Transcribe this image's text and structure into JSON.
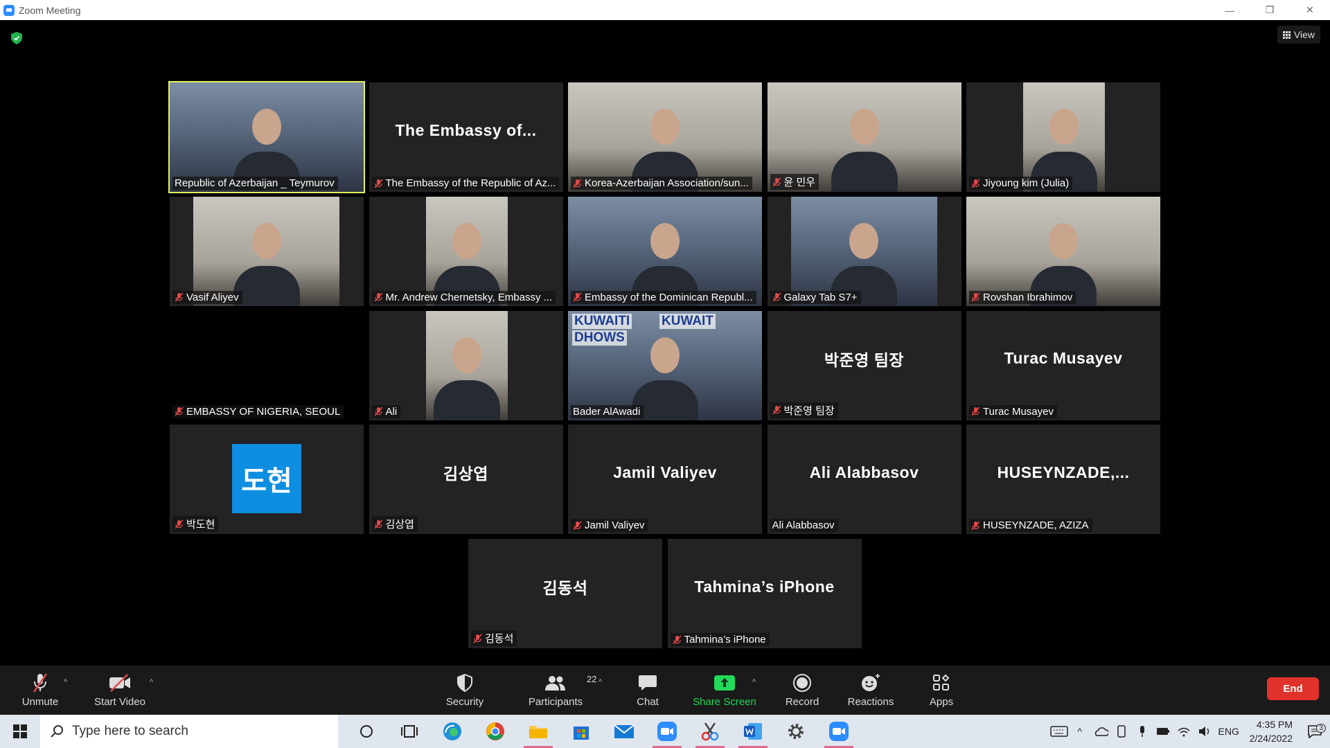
{
  "window": {
    "title": "Zoom Meeting"
  },
  "view_button": {
    "label": "View"
  },
  "participants": [
    {
      "name": "Republic of Azerbaijan _ Teymurov",
      "muted": false,
      "video": "office",
      "active": true
    },
    {
      "name": "The Embassy of the Republic of Az...",
      "muted": true,
      "display": "The  Embassy  of..."
    },
    {
      "name": "Korea-Azerbaijan Association/sun...",
      "muted": true,
      "video": "room"
    },
    {
      "name": "윤 민우",
      "muted": true,
      "video": "room"
    },
    {
      "name": "Jiyoung kim (Julia)",
      "muted": true,
      "video": "room"
    },
    {
      "name": "Vasif Aliyev",
      "muted": true,
      "video": "room"
    },
    {
      "name": "Mr. Andrew Chernetsky, Embassy ...",
      "muted": true,
      "video": "room"
    },
    {
      "name": "Embassy of the Dominican Republ...",
      "muted": true,
      "video": "office"
    },
    {
      "name": "Galaxy Tab S7+",
      "muted": true,
      "video": "office"
    },
    {
      "name": "Rovshan Ibrahimov",
      "muted": true,
      "video": "room"
    },
    {
      "name": "EMBASSY OF NIGERIA, SEOUL",
      "muted": true,
      "video": "dark"
    },
    {
      "name": "Ali",
      "muted": true,
      "video": "room"
    },
    {
      "name": "Bader AlAwadi",
      "muted": false,
      "video": "office",
      "poster_text": [
        "KUWAITI",
        "DHOWS",
        "KUWAIT"
      ]
    },
    {
      "name": "박준영 팀장",
      "muted": true,
      "display": "박준영 팀장"
    },
    {
      "name": "Turac Musayev",
      "muted": true,
      "display": "Turac Musayev"
    },
    {
      "name": "박도현",
      "muted": true,
      "avatar": "도현",
      "avatar_color": "#0e8ee0"
    },
    {
      "name": "김상엽",
      "muted": true,
      "display": "김상엽"
    },
    {
      "name": "Jamil Valiyev",
      "muted": true,
      "display": "Jamil Valiyev"
    },
    {
      "name": "Ali Alabbasov",
      "muted": false,
      "display": "Ali Alabbasov"
    },
    {
      "name": "HUSEYNZADE, AZIZA",
      "muted": true,
      "display": "HUSEYNZADE,..."
    },
    {
      "name": "김동석",
      "muted": true,
      "display": "김동석"
    },
    {
      "name": "Tahmina’s iPhone",
      "muted": true,
      "display": "Tahmina’s iPhone"
    }
  ],
  "controls": {
    "unmute": "Unmute",
    "start_video": "Start Video",
    "security": "Security",
    "participants": "Participants",
    "participant_count": "22",
    "chat": "Chat",
    "share_screen": "Share Screen",
    "record": "Record",
    "reactions": "Reactions",
    "apps": "Apps",
    "end": "End"
  },
  "taskbar": {
    "search_placeholder": "Type here to search",
    "language": "ENG",
    "time": "4:35 PM",
    "date": "2/24/2022",
    "notification_count": "3"
  },
  "colors": {
    "active_speaker": "#e4f35e",
    "share_green": "#23d959",
    "end_red": "#e0312a",
    "mute_red": "#e24a4a"
  }
}
